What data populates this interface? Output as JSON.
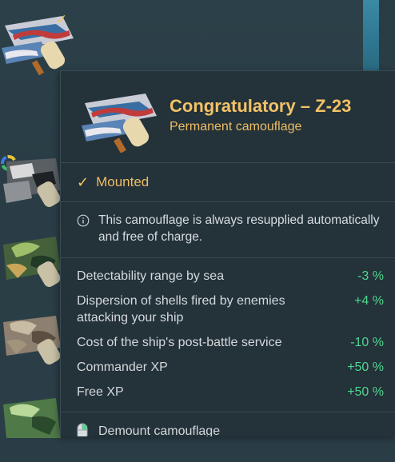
{
  "camouflage_list": {
    "items": [
      {
        "name": "congratulatory-camo",
        "mounted": true
      },
      {
        "name": "dark-grey-camo",
        "mounted": false
      },
      {
        "name": "green-camo",
        "mounted": false
      },
      {
        "name": "brown-camo",
        "mounted": false
      },
      {
        "name": "green-light-camo",
        "mounted": false
      }
    ]
  },
  "tooltip": {
    "title": "Congratulatory – Z-23",
    "subtitle": "Permanent camouflage",
    "status": {
      "label": "Mounted",
      "icon": "checkmark-icon"
    },
    "info": {
      "icon": "info-circle-icon",
      "text": "This camouflage is always resupplied automatically and free of charge."
    },
    "stats": [
      {
        "label": "Detectability range by sea",
        "value": "-3 %"
      },
      {
        "label": "Dispersion of shells fired by enemies attacking your ship",
        "value": "+4 %"
      },
      {
        "label": "Cost of the ship's post-battle service",
        "value": "-10 %"
      },
      {
        "label": "Commander XP",
        "value": "+50 %"
      },
      {
        "label": "Free XP",
        "value": "+50 %"
      }
    ],
    "footer": {
      "icon": "mouse-icon",
      "label": "Demount camouflage"
    }
  },
  "colors": {
    "title": "#f3c267",
    "positive_stat": "#4fd68f",
    "background": "#243239"
  }
}
